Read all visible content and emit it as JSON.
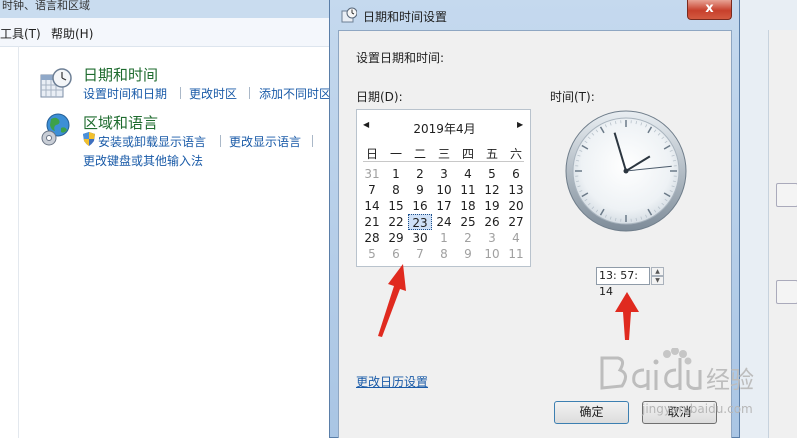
{
  "background_window": {
    "title": "时钟、语言和区域",
    "menu": [
      "工具(T)",
      "帮助(H)"
    ],
    "categories": [
      {
        "title": "日期和时间",
        "links": [
          "设置时间和日期",
          "更改时区",
          "添加不同时区"
        ]
      },
      {
        "title": "区域和语言",
        "links": [
          "安装或卸载显示语言",
          "更改显示语言",
          "更改键盘或其他输入法"
        ]
      }
    ]
  },
  "dialog": {
    "title": "日期和时间设置",
    "close_label": "x",
    "heading": "设置日期和时间:",
    "date_label": "日期(D):",
    "time_label": "时间(T):",
    "calendar": {
      "month_title": "2019年4月",
      "weekdays": [
        "日",
        "一",
        "二",
        "三",
        "四",
        "五",
        "六"
      ],
      "weeks": [
        [
          "31",
          "1",
          "2",
          "3",
          "4",
          "5",
          "6"
        ],
        [
          "7",
          "8",
          "9",
          "10",
          "11",
          "12",
          "13"
        ],
        [
          "14",
          "15",
          "16",
          "17",
          "18",
          "19",
          "20"
        ],
        [
          "21",
          "22",
          "23",
          "24",
          "25",
          "26",
          "27"
        ],
        [
          "28",
          "29",
          "30",
          "1",
          "2",
          "3",
          "4"
        ],
        [
          "5",
          "6",
          "7",
          "8",
          "9",
          "10",
          "11"
        ]
      ],
      "selected_day": "23"
    },
    "clock": {
      "hour": 13,
      "minute": 57,
      "second": 14
    },
    "time_value": "13: 57: 14",
    "calendar_settings_link": "更改日历设置",
    "ok_label": "确定",
    "cancel_label": "取消"
  },
  "watermark": {
    "text": "jingyan.baidu.com"
  },
  "colors": {
    "accent_link": "#1a5ba8",
    "category_title": "#1e6b2e",
    "annotation_arrow": "#e02a1f"
  }
}
